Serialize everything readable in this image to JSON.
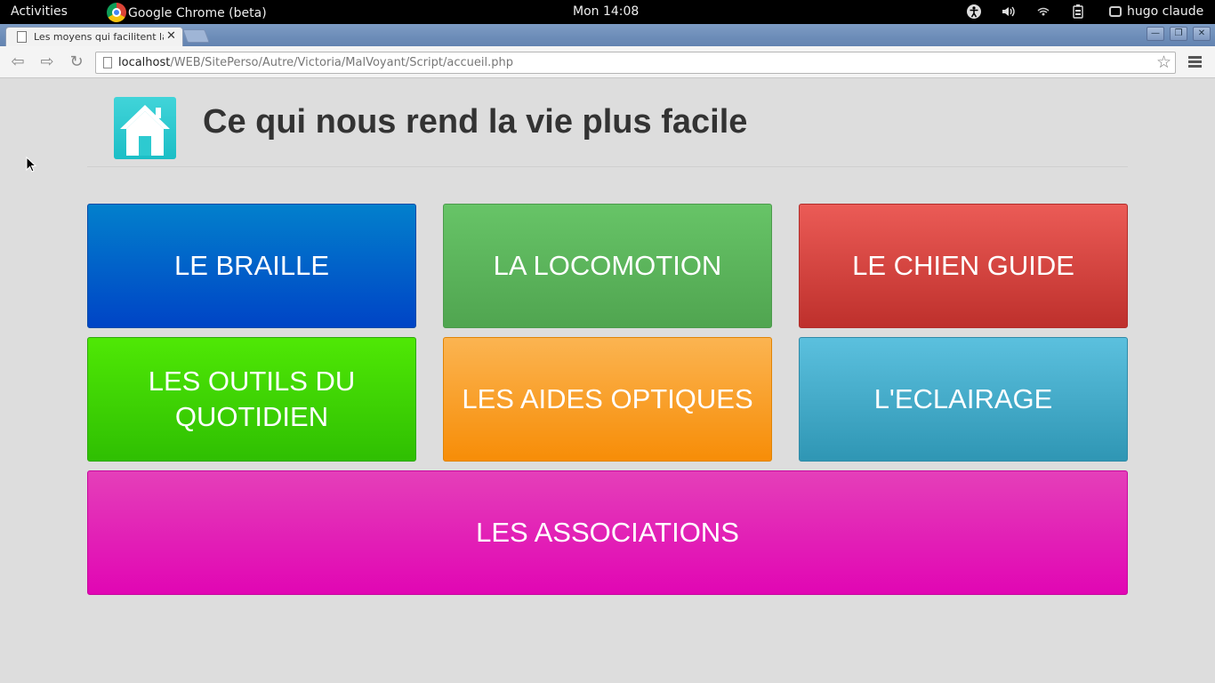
{
  "system_bar": {
    "activities": "Activities",
    "app_name": "Google Chrome (beta)",
    "clock": "Mon 14:08",
    "user": "hugo claude",
    "tray_icons": [
      "accessibility-icon",
      "volume-icon",
      "network-icon",
      "battery-icon"
    ]
  },
  "browser": {
    "tab_title": "Les moyens qui facilitent la",
    "url_host": "localhost",
    "url_path": "/WEB/SitePerso/Autre/Victoria/MalVoyant/Script/accueil.php"
  },
  "page": {
    "title": "Ce qui nous rend la vie plus facile",
    "tiles": {
      "braille": "LE BRAILLE",
      "locomotion": "LA LOCOMOTION",
      "chien_guide": "LE CHIEN GUIDE",
      "outils_line1": "LES OUTILS DU",
      "outils_line2": "QUOTIDIEN",
      "aides_optiques": "LES AIDES OPTIQUES",
      "eclairage": "L'ECLAIRAGE",
      "associations": "LES ASSOCIATIONS"
    }
  },
  "colors": {
    "braille": "#0262c9",
    "locomotion": "#5cb85c",
    "chien_guide": "#d9534f",
    "outils": "#3fd404",
    "aides_optiques": "#f89f23",
    "eclairage": "#46abc9",
    "associations": "#e222b7",
    "home_logo": "#2dcad0"
  }
}
